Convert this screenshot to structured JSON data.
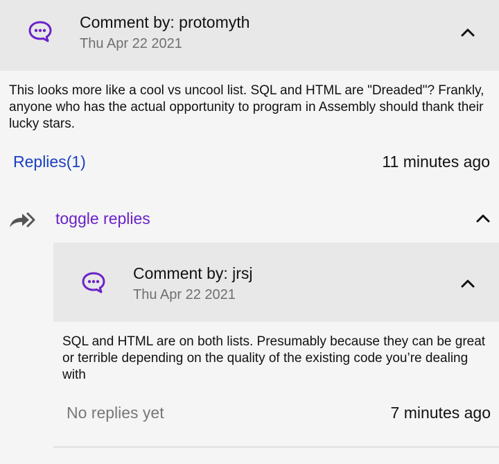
{
  "comment": {
    "author": "Comment by: protomyth",
    "date": "Thu Apr 22 2021",
    "body": "This looks more like a cool vs uncool list.  SQL and HTML are \"Dreaded\"? Frankly, anyone who has the actual opportunity to program in Assembly should thank their lucky stars.",
    "replies_label": "Replies(1)",
    "time_ago": "11 minutes ago",
    "toggle_label": "toggle replies"
  },
  "reply": {
    "author": "Comment by: jrsj",
    "date": "Thu Apr 22 2021",
    "body": "SQL and HTML are on both lists. Presumably because they can be great or terrible depending on the quality of the existing code you’re dealing with",
    "replies_label": "No replies yet",
    "time_ago": "7 minutes ago"
  },
  "colors": {
    "icon_purple": "#6a22c8",
    "link_blue": "#1a3fc1",
    "header_bg": "#e8e8e8"
  },
  "icons": {
    "comment": "speech-bubble-icon",
    "collapse": "chevron-up-icon",
    "reply": "reply-arrow-icon"
  }
}
